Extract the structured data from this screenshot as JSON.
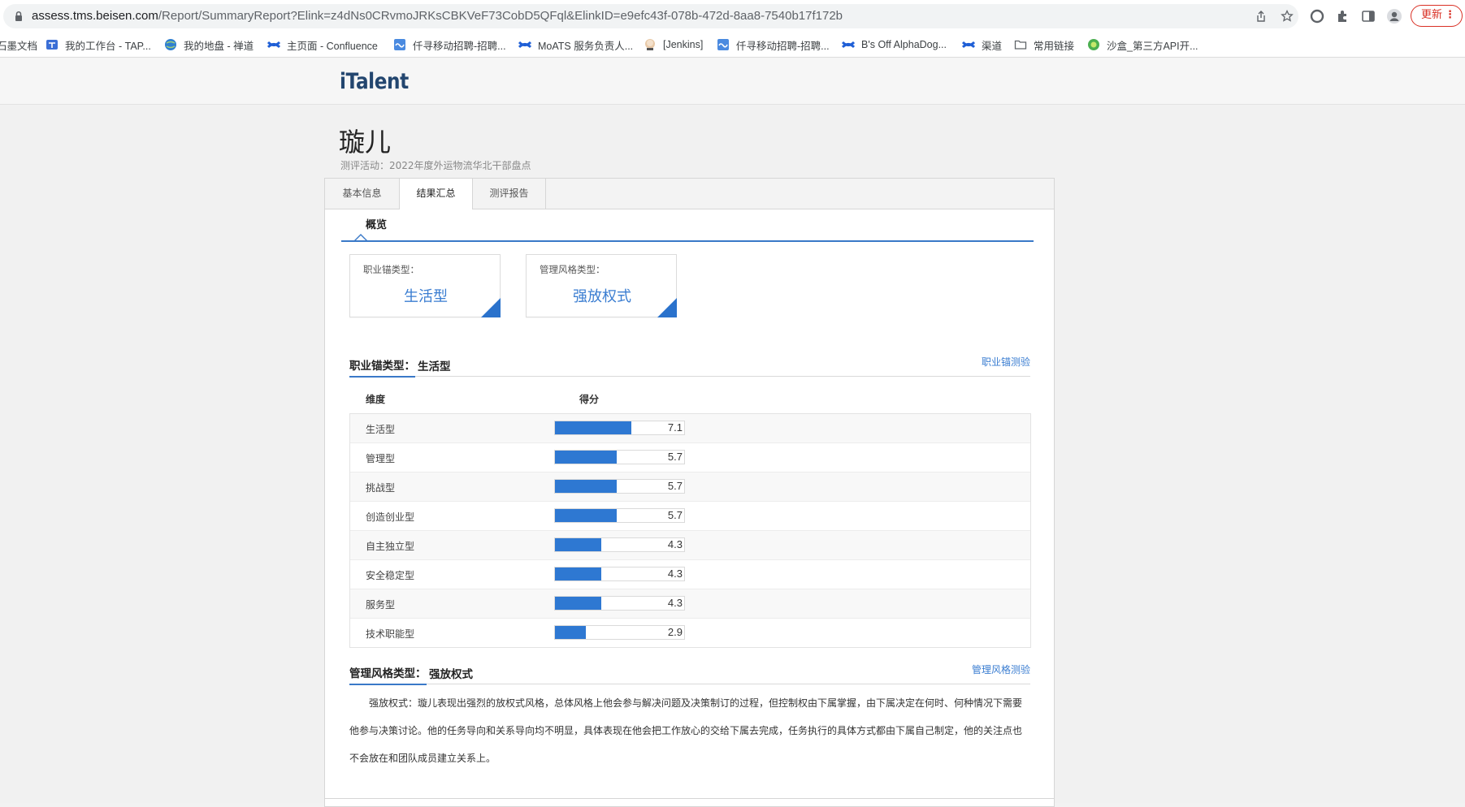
{
  "browser": {
    "url_host": "assess.tms.beisen.com",
    "url_path": "/Report/SummaryReport?Elink=z4dNs0CRvmoJRKsCBKVeF73CobD5QFql&ElinkID=e9efc43f-078b-472d-8aa8-7540b17f172b",
    "update_label": "更新",
    "menu_dots": "⋮"
  },
  "bookmarks": [
    {
      "label": "石墨文档",
      "icon": "doc-icon",
      "color": "#555555"
    },
    {
      "label": "我的工作台 - TAP...",
      "icon": "tap-icon",
      "color": "#3b6fd6"
    },
    {
      "label": "我的地盘 - 禅道",
      "icon": "globe-icon",
      "color": "#2f7fd1"
    },
    {
      "label": "主页面 - Confluence",
      "icon": "confluence-icon",
      "color": "#1f5fd6"
    },
    {
      "label": "仟寻移动招聘-招聘...",
      "icon": "moseeker-icon",
      "color": "#4a8ae0"
    },
    {
      "label": "MoATS 服务负责人...",
      "icon": "confluence-icon",
      "color": "#1f5fd6"
    },
    {
      "label": "[Jenkins]",
      "icon": "jenkins-icon",
      "color": "#c9a27a"
    },
    {
      "label": "仟寻移动招聘-招聘...",
      "icon": "moseeker-icon",
      "color": "#4a8ae0"
    },
    {
      "label": "B's Off AlphaDog...",
      "icon": "confluence-icon",
      "color": "#1f5fd6"
    },
    {
      "label": "渠道",
      "icon": "confluence-icon",
      "color": "#1f5fd6"
    },
    {
      "label": "常用链接",
      "icon": "folder-icon",
      "color": "#5f6368"
    },
    {
      "label": "沙盒_第三方API开...",
      "icon": "sandbox-icon",
      "color": "#4caf50"
    }
  ],
  "site": {
    "logo": "iTalent",
    "person_name": "璇儿",
    "activity": "测评活动：2022年度外运物流华北干部盘点"
  },
  "tabs": [
    {
      "label": "基本信息",
      "active": false
    },
    {
      "label": "结果汇总",
      "active": true
    },
    {
      "label": "测评报告",
      "active": false
    }
  ],
  "overview": {
    "title": "概览",
    "cards": [
      {
        "label": "职业锚类型：",
        "value": "生活型"
      },
      {
        "label": "管理风格类型：",
        "value": "强放权式"
      }
    ]
  },
  "career_anchor": {
    "label": "职业锚类型：",
    "value": "生活型",
    "link": "职业锚测验",
    "col_dimension": "维度",
    "col_score": "得分",
    "max_score": 12,
    "rows": [
      {
        "name": "生活型",
        "score": "7.1"
      },
      {
        "name": "管理型",
        "score": "5.7"
      },
      {
        "name": "挑战型",
        "score": "5.7"
      },
      {
        "name": "创造创业型",
        "score": "5.7"
      },
      {
        "name": "自主独立型",
        "score": "4.3"
      },
      {
        "name": "安全稳定型",
        "score": "4.3"
      },
      {
        "name": "服务型",
        "score": "4.3"
      },
      {
        "name": "技术职能型",
        "score": "2.9"
      }
    ]
  },
  "mgmt_style": {
    "label": "管理风格类型：",
    "value": "强放权式",
    "link": "管理风格测验",
    "description": "强放权式：璇儿表现出强烈的放权式风格，总体风格上他会参与解决问题及决策制订的过程，但控制权由下属掌握，由下属决定在何时、何种情况下需要他参与决策讨论。他的任务导向和关系导向均不明显，具体表现在他会把工作放心的交给下属去完成，任务执行的具体方式都由下属自己制定，他的关注点也不会放在和团队成员建立关系上。"
  }
}
